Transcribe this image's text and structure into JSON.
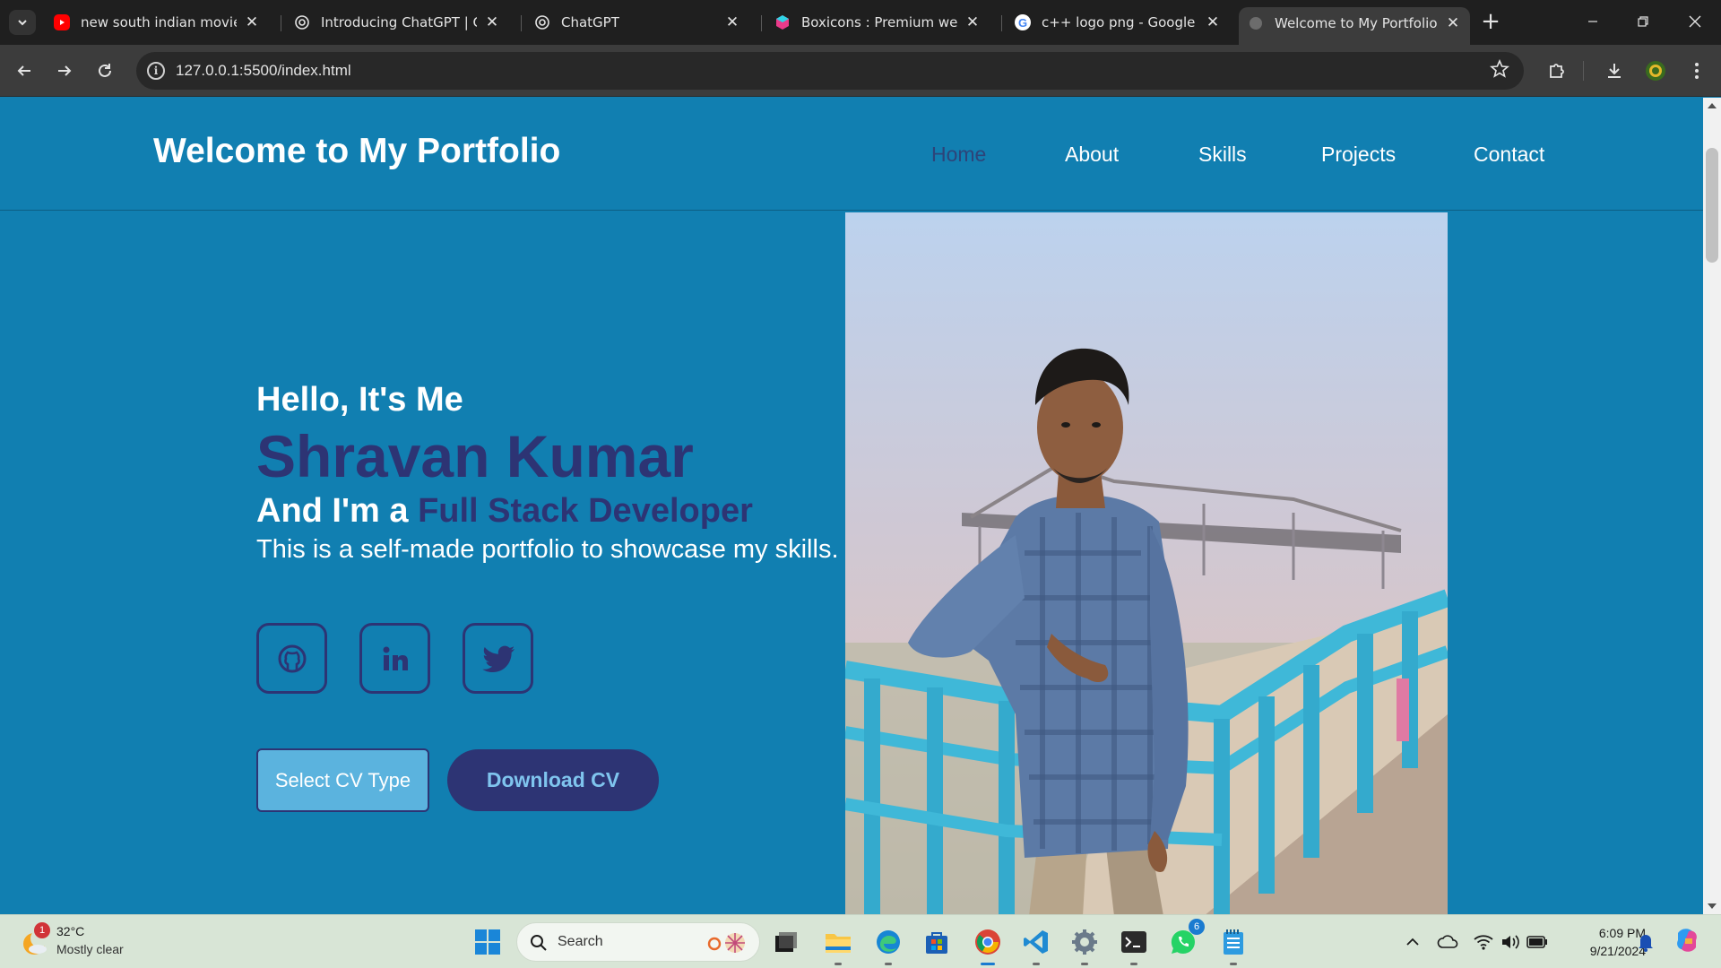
{
  "browser": {
    "tabs": [
      {
        "title": "new south indian movies d",
        "icon": "youtube-icon"
      },
      {
        "title": "Introducing ChatGPT | Ope",
        "icon": "openai-icon"
      },
      {
        "title": "ChatGPT",
        "icon": "openai-icon"
      },
      {
        "title": "Boxicons : Premium web fr",
        "icon": "boxicons-icon"
      },
      {
        "title": "c++ logo png - Google Se",
        "icon": "google-icon"
      },
      {
        "title": "Welcome to My Portfolio",
        "icon": "globe-icon",
        "active": true
      }
    ],
    "url": "127.0.0.1:5500/index.html"
  },
  "site": {
    "title": "Welcome to My Portfolio",
    "nav": [
      "Home",
      "About",
      "Skills",
      "Projects",
      "Contact"
    ],
    "active_nav": "Home"
  },
  "hero": {
    "greeting": "Hello, It's Me",
    "name": "Shravan Kumar",
    "role_prefix": "And I'm a ",
    "role": "Full Stack Developer",
    "description": "This is a self-made portfolio to showcase my skills.",
    "social": [
      "github-icon",
      "linkedin-icon",
      "twitter-icon"
    ],
    "select_cv": "Select CV Type",
    "download_cv": "Download CV"
  },
  "colors": {
    "page_bg": "#117fb1",
    "accent": "#2d3474",
    "button_light": "#5bb3de",
    "taskbar": "#d8e5d6"
  },
  "taskbar": {
    "weather_temp": "32°C",
    "weather_desc": "Mostly clear",
    "weather_badge": "1",
    "search_placeholder": "Search",
    "whatsapp_badge": "6",
    "time": "6:09 PM",
    "date": "9/21/2024",
    "apps": [
      "windows-start-icon",
      "task-view-icon",
      "file-explorer-icon",
      "edge-icon",
      "microsoft-store-icon",
      "chrome-icon",
      "vscode-icon",
      "settings-icon",
      "terminal-icon",
      "whatsapp-icon",
      "notepad-icon"
    ]
  }
}
